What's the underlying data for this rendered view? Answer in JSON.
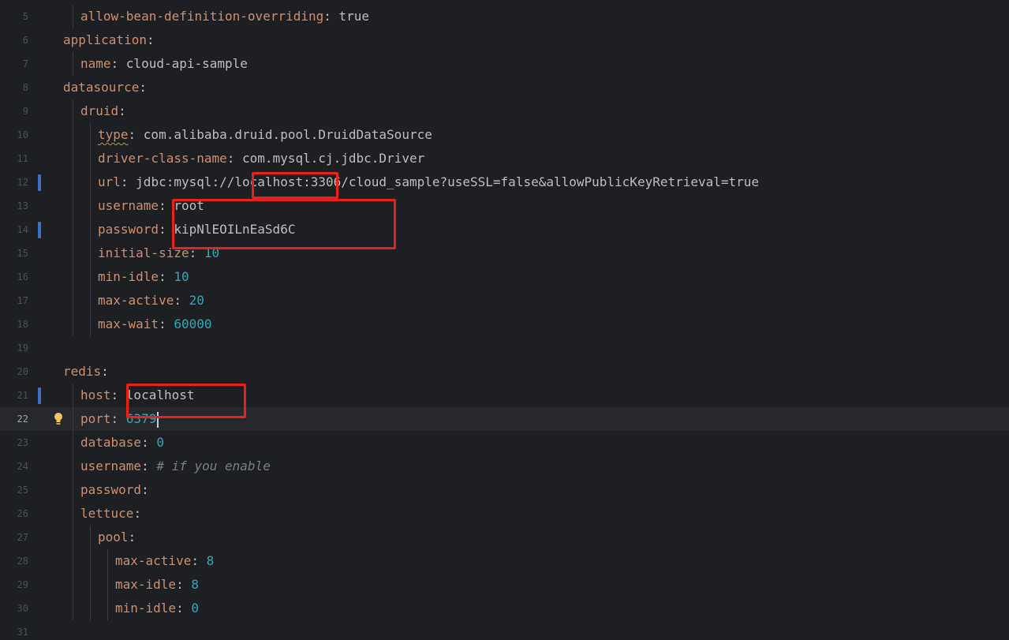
{
  "editor": {
    "language": "yaml",
    "current_line": "22",
    "lines": [
      {
        "num": "5",
        "indent": 2,
        "key": "allow-bean-definition-overriding",
        "value": "true",
        "vtype": "val"
      },
      {
        "num": "6",
        "indent": 1,
        "key": "application",
        "value": "",
        "vtype": "val"
      },
      {
        "num": "7",
        "indent": 2,
        "key": "name",
        "value": "cloud-api-sample",
        "vtype": "val"
      },
      {
        "num": "8",
        "indent": 1,
        "key": "datasource",
        "value": "",
        "vtype": "val"
      },
      {
        "num": "9",
        "indent": 2,
        "key": "druid",
        "value": "",
        "vtype": "val"
      },
      {
        "num": "10",
        "indent": 3,
        "key": "type",
        "value": "com.alibaba.druid.pool.DruidDataSource",
        "vtype": "val",
        "squiggle": true
      },
      {
        "num": "11",
        "indent": 3,
        "key": "driver-class-name",
        "value": "com.mysql.cj.jdbc.Driver",
        "vtype": "val"
      },
      {
        "num": "12",
        "indent": 3,
        "key": "url",
        "value": "jdbc:mysql://localhost:3306/cloud_sample?useSSL=false&allowPublicKeyRetrieval=true",
        "vtype": "val",
        "changed": true
      },
      {
        "num": "13",
        "indent": 3,
        "key": "username",
        "value": "root",
        "vtype": "val"
      },
      {
        "num": "14",
        "indent": 3,
        "key": "password",
        "value": "kipNlEOILnEaSd6C",
        "vtype": "val",
        "changed": true
      },
      {
        "num": "15",
        "indent": 3,
        "key": "initial-size",
        "value": "10",
        "vtype": "num"
      },
      {
        "num": "16",
        "indent": 3,
        "key": "min-idle",
        "value": "10",
        "vtype": "num"
      },
      {
        "num": "17",
        "indent": 3,
        "key": "max-active",
        "value": "20",
        "vtype": "num"
      },
      {
        "num": "18",
        "indent": 3,
        "key": "max-wait",
        "value": "60000",
        "vtype": "num"
      },
      {
        "num": "19",
        "indent": 0,
        "key": "",
        "value": "",
        "vtype": "val"
      },
      {
        "num": "20",
        "indent": 1,
        "key": "redis",
        "value": "",
        "vtype": "val"
      },
      {
        "num": "21",
        "indent": 2,
        "key": "host",
        "value": "localhost",
        "vtype": "val",
        "changed": true
      },
      {
        "num": "22",
        "indent": 2,
        "key": "port",
        "value": "6379",
        "vtype": "num",
        "current": true,
        "bulb": true
      },
      {
        "num": "23",
        "indent": 2,
        "key": "database",
        "value": "0",
        "vtype": "num"
      },
      {
        "num": "24",
        "indent": 2,
        "key": "username",
        "value": "# if you enable",
        "vtype": "comment"
      },
      {
        "num": "25",
        "indent": 2,
        "key": "password",
        "value": "",
        "vtype": "val"
      },
      {
        "num": "26",
        "indent": 2,
        "key": "lettuce",
        "value": "",
        "vtype": "val"
      },
      {
        "num": "27",
        "indent": 3,
        "key": "pool",
        "value": "",
        "vtype": "val"
      },
      {
        "num": "28",
        "indent": 4,
        "key": "max-active",
        "value": "8",
        "vtype": "num"
      },
      {
        "num": "29",
        "indent": 4,
        "key": "max-idle",
        "value": "8",
        "vtype": "num"
      },
      {
        "num": "30",
        "indent": 4,
        "key": "min-idle",
        "value": "0",
        "vtype": "num"
      },
      {
        "num": "31",
        "indent": 0,
        "key": "",
        "value": "",
        "vtype": "val"
      }
    ]
  },
  "annotations": [
    {
      "label": "localhost-in-url-highlight"
    },
    {
      "label": "credentials-highlight"
    },
    {
      "label": "redis-host-highlight"
    }
  ],
  "colors": {
    "background": "#1e1f22",
    "key": "#cf8e6d",
    "number": "#2aacb8",
    "comment": "#7a7e85",
    "annotation": "#e8221b"
  }
}
